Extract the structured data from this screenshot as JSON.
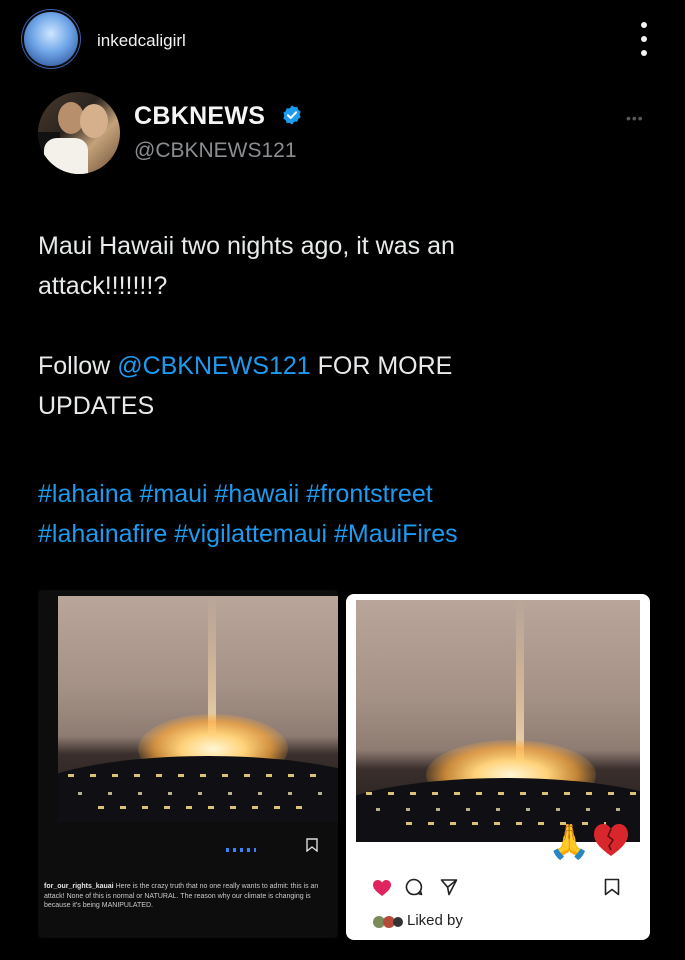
{
  "instagram": {
    "username": "inkedcaligirl"
  },
  "tweet": {
    "display_name": "CBKNEWS",
    "handle": "@CBKNEWS121",
    "line1a": "Maui Hawaii two nights ago, it was an",
    "line1b": "attack!!!!!!!?",
    "follow_pre": "Follow ",
    "follow_mention": "@CBKNEWS121",
    "follow_post": " FOR MORE",
    "follow_line2": "UPDATES",
    "hashtags_line1": "#lahaina #maui #hawaii #frontstreet",
    "hashtags_line2": "#lahainafire #vigilattemaui #MauiFires"
  },
  "embedded_left": {
    "caption_user": "for_our_rights_kauai",
    "caption_text": "Here is the crazy truth that no one really wants to admit: this is an attack! None of this is normal or NATURAL. The reason why our climate is changing is because it's being MANIPULATED."
  },
  "embedded_right": {
    "liked_by": "Liked by"
  },
  "colors": {
    "accent": "#1d9bf0",
    "background": "#000000",
    "like": "#e0245e"
  },
  "icons": [
    "more-vert-icon",
    "verified-badge-icon",
    "heart-icon",
    "comment-icon",
    "share-icon",
    "bookmark-icon"
  ]
}
